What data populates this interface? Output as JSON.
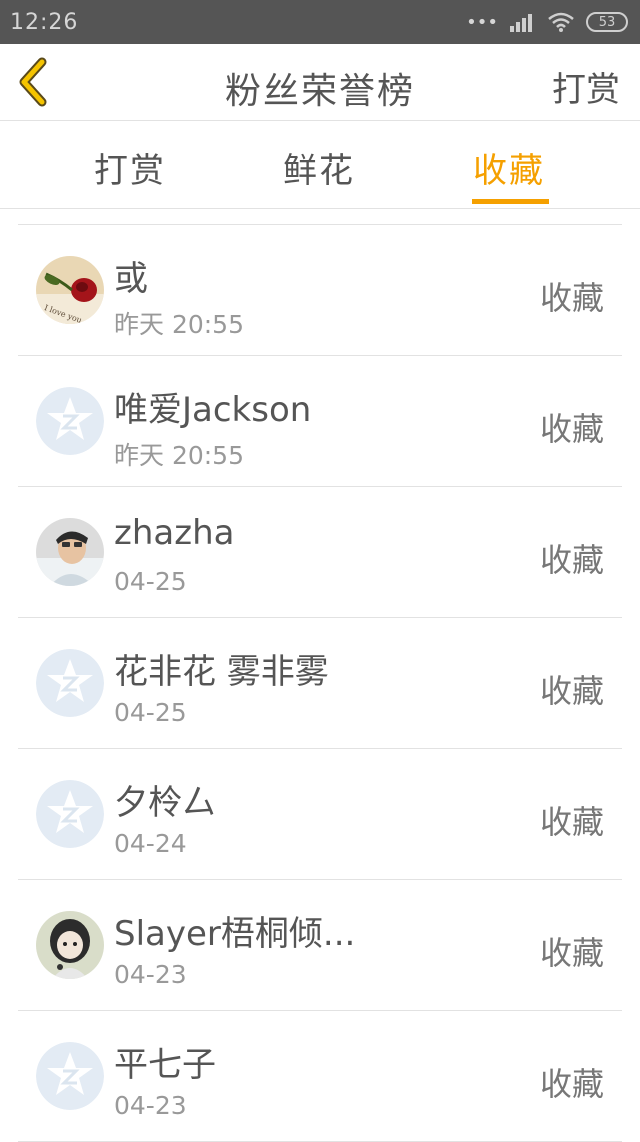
{
  "status": {
    "time": "12:26",
    "battery": "53"
  },
  "header": {
    "title": "粉丝荣誉榜",
    "right_label": "打赏"
  },
  "tabs": [
    {
      "label": "打赏"
    },
    {
      "label": "鲜花"
    },
    {
      "label": "收藏"
    }
  ],
  "active_tab": "收藏",
  "accent_color": "#f5a000",
  "list": [
    {
      "name": "或",
      "time": "昨天 20:55",
      "action": "收藏",
      "avatar": "rose-photo"
    },
    {
      "name": "唯爱Jackson",
      "time": "昨天 20:55",
      "action": "收藏",
      "avatar": "default-star-icon"
    },
    {
      "name": "zhazha",
      "time": "04-25",
      "action": "收藏",
      "avatar": "person-photo"
    },
    {
      "name": "花非花 雾非雾",
      "time": "04-25",
      "action": "收藏",
      "avatar": "default-star-icon"
    },
    {
      "name": "夕柃厶",
      "time": "04-24",
      "action": "收藏",
      "avatar": "default-star-icon"
    },
    {
      "name": "Slayer梧桐倾...",
      "time": "04-23",
      "action": "收藏",
      "avatar": "anime-photo"
    },
    {
      "name": "平七子",
      "time": "04-23",
      "action": "收藏",
      "avatar": "default-star-icon"
    }
  ]
}
